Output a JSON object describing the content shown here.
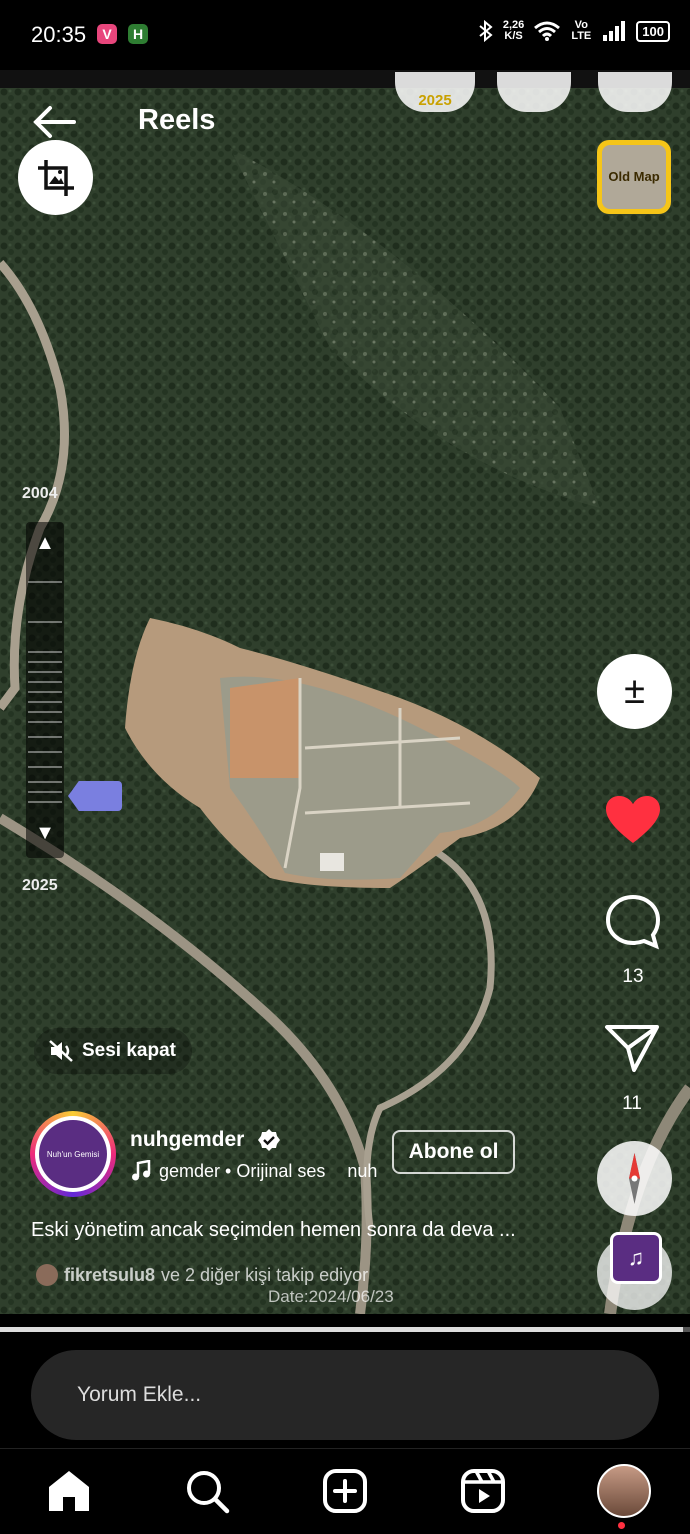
{
  "status_bar": {
    "time": "20:35",
    "app_badges": [
      "V",
      "H"
    ],
    "net_speed_value": "2,26",
    "net_speed_unit": "K/S",
    "network_type": "Vo LTE",
    "battery": "100",
    "icons": [
      "bluetooth-icon",
      "wifi-icon",
      "signal-icon",
      "battery-icon"
    ]
  },
  "header": {
    "title": "Reels",
    "map_year_chip": "2025",
    "old_map_label": "Old Map"
  },
  "timeline": {
    "start_year": "2004",
    "end_year": "2025"
  },
  "actions": {
    "like_color": "#ff3040",
    "comment_count": "13",
    "share_count": "11"
  },
  "sound": {
    "mute_label": "Sesi kapat"
  },
  "post": {
    "avatar_text": "Nuh'un Gemisi",
    "username": "nuhgemder",
    "audio_text": "gemder • Orijinal ses",
    "audio_overflow": "nuh",
    "follow_label": "Abone ol",
    "caption": "Eski yönetim ancak seçimden hemen sonra da deva ...",
    "followed_by_user": "fikretsulu8",
    "followed_by_rest": "ve 2 diğer kişi takip ediyor",
    "date_overlay": "Date:2024/06/23",
    "progress": 0.99
  },
  "comment": {
    "placeholder": "Yorum Ekle..."
  },
  "nav": {
    "items": [
      "home-icon",
      "search-icon",
      "create-icon",
      "reels-icon",
      "profile-avatar"
    ],
    "notification_color": "#ff3040"
  }
}
